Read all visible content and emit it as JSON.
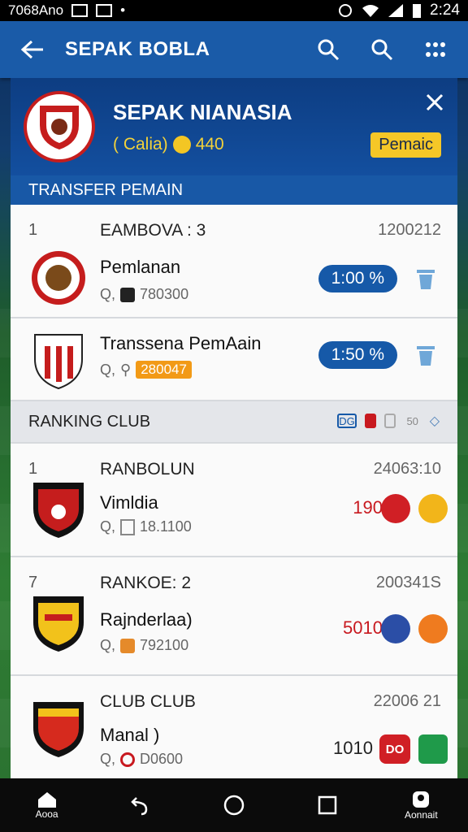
{
  "status_bar": {
    "left_text": "7068Ano",
    "time": "2:24"
  },
  "app_bar": {
    "title": "SEPAK BOBLA"
  },
  "club_header": {
    "name": "SEPAK NIANASIA",
    "stats_label": "( Calia)",
    "coins": "440",
    "badge_label": "Pemaic"
  },
  "transfer_section": {
    "title": "TRANSFER PEMAIN"
  },
  "transfer_rows": [
    {
      "num": "1",
      "title": "EAMBOVA : 3",
      "date": "1200212",
      "name": "Pemlanan",
      "meta": "780300",
      "pill": "1:00 %"
    },
    {
      "name": "Transsena PemAain",
      "meta": "280047",
      "pill": "1:50 %"
    }
  ],
  "ranking_section": {
    "title": "RANKING CLUB",
    "icon_text_1": "DG",
    "icon_text_2": "50"
  },
  "ranking_rows": [
    {
      "num": "1",
      "title": "RANBOLUN",
      "date": "24063:10",
      "name": "Vimldia",
      "meta": "18.1100",
      "score": "190"
    },
    {
      "num": "7",
      "title": "RANKOE: 2",
      "date": "200341S",
      "name": "Rajnderlaa)",
      "meta": "792100",
      "score": "5010"
    },
    {
      "title": "CLUB CLUB",
      "date": "22006 21",
      "name": "Manal )",
      "meta": "D0600",
      "score": "1010",
      "badge_text": "DO"
    }
  ],
  "nav_bar": {
    "home_label": "Aooa",
    "account_label": "Aonnait"
  },
  "colors": {
    "primary": "#1a5ba8",
    "header": "#0d3d82",
    "accent": "#f5c727",
    "score_red": "#c8191f"
  }
}
